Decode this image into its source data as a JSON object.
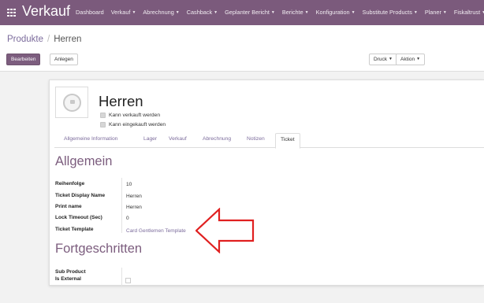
{
  "app": {
    "title": "Verkauf"
  },
  "nav": [
    {
      "label": "Dashboard",
      "dropdown": false
    },
    {
      "label": "Verkauf",
      "dropdown": true
    },
    {
      "label": "Abrechnung",
      "dropdown": true
    },
    {
      "label": "Cashback",
      "dropdown": true
    },
    {
      "label": "Geplanter Bericht",
      "dropdown": true
    },
    {
      "label": "Berichte",
      "dropdown": true
    },
    {
      "label": "Konfiguration",
      "dropdown": true
    },
    {
      "label": "Substitute Products",
      "dropdown": true
    },
    {
      "label": "Planer",
      "dropdown": true
    },
    {
      "label": "Fiskaltrust",
      "dropdown": true
    }
  ],
  "breadcrumb": {
    "parent": "Produkte",
    "separator": "/",
    "current": "Herren"
  },
  "buttons": {
    "edit": "Bearbeiten",
    "create": "Anlegen",
    "print": "Druck",
    "action": "Aktion"
  },
  "product": {
    "name": "Herren",
    "can_be_sold": "Kann verkauft werden",
    "can_be_purchased": "Kann eingekauft werden"
  },
  "tabs": [
    {
      "label": "Allgemeine Information",
      "active": false
    },
    {
      "label": "Lager",
      "active": false
    },
    {
      "label": "Verkauf",
      "active": false
    },
    {
      "label": "Abrechnung",
      "active": false
    },
    {
      "label": "Notizen",
      "active": false
    },
    {
      "label": "Ticket",
      "active": true
    }
  ],
  "sections": {
    "general": {
      "title": "Allgemein",
      "fields": [
        {
          "label": "Reihenfolge",
          "value": "10"
        },
        {
          "label": "Ticket Display Name",
          "value": "Herren"
        },
        {
          "label": "Print name",
          "value": "Herren"
        },
        {
          "label": "Lock Timeout (Sec)",
          "value": "0"
        },
        {
          "label": "Ticket Template",
          "value": "Card Gentlemen Template"
        }
      ]
    },
    "advanced": {
      "title": "Fortgeschritten",
      "field_label_line1": "Sub Product",
      "field_label_line2": "Is External",
      "is_external": false
    }
  },
  "colors": {
    "navbar": "#7b5a7c",
    "primary_button": "#7c5d7e",
    "link": "#7c6c9c",
    "section_title": "#7c5d7e",
    "annotation_arrow": "#e02020"
  },
  "icons": {
    "apps": "apps-grid-icon",
    "avatar": "camera-placeholder-icon",
    "annotation": "red-arrow-annotation"
  }
}
